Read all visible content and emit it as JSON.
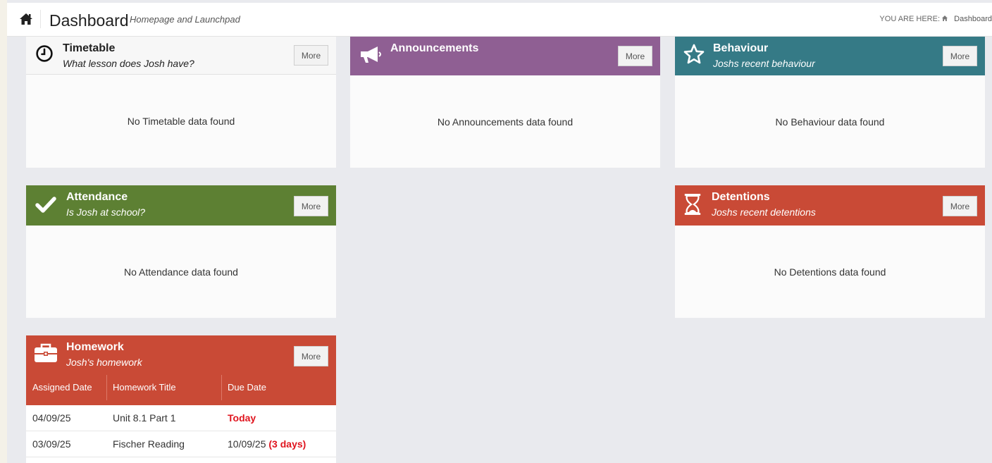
{
  "header": {
    "title": "Dashboard",
    "subtitle": "Homepage and Launchpad",
    "breadcrumb_label": "YOU ARE HERE:",
    "breadcrumb_current": "Dashboard"
  },
  "colors": {
    "announcements": "#8f5f93",
    "behaviour": "#357a86",
    "attendance": "#5d8033",
    "detentions": "#c94a36",
    "homework": "#c94a36",
    "due_highlight": "#e0141e"
  },
  "panels": {
    "timetable": {
      "title": "Timetable",
      "subtitle": "What lesson does Josh have?",
      "more": "More",
      "empty": "No Timetable data found",
      "icon": "clock-icon"
    },
    "announcements": {
      "title": "Announcements",
      "subtitle": "",
      "more": "More",
      "empty": "No Announcements data found",
      "icon": "megaphone-icon"
    },
    "behaviour": {
      "title": "Behaviour",
      "subtitle": "Joshs recent behaviour",
      "more": "More",
      "empty": "No Behaviour data found",
      "icon": "star-icon"
    },
    "attendance": {
      "title": "Attendance",
      "subtitle": "Is Josh at school?",
      "more": "More",
      "empty": "No Attendance data found",
      "icon": "check-icon"
    },
    "detentions": {
      "title": "Detentions",
      "subtitle": "Joshs recent detentions",
      "more": "More",
      "empty": "No Detentions data found",
      "icon": "hourglass-icon"
    },
    "homework": {
      "title": "Homework",
      "subtitle": "Josh's homework",
      "more": "More",
      "icon": "briefcase-icon",
      "columns": [
        "Assigned Date",
        "Homework Title",
        "Due Date"
      ],
      "rows": [
        {
          "assigned": "04/09/25",
          "title": "Unit 8.1 Part 1",
          "due": "",
          "due_note": "Today"
        },
        {
          "assigned": "03/09/25",
          "title": "Fischer Reading",
          "due": "10/09/25",
          "due_note": "(3 days)"
        }
      ]
    }
  }
}
